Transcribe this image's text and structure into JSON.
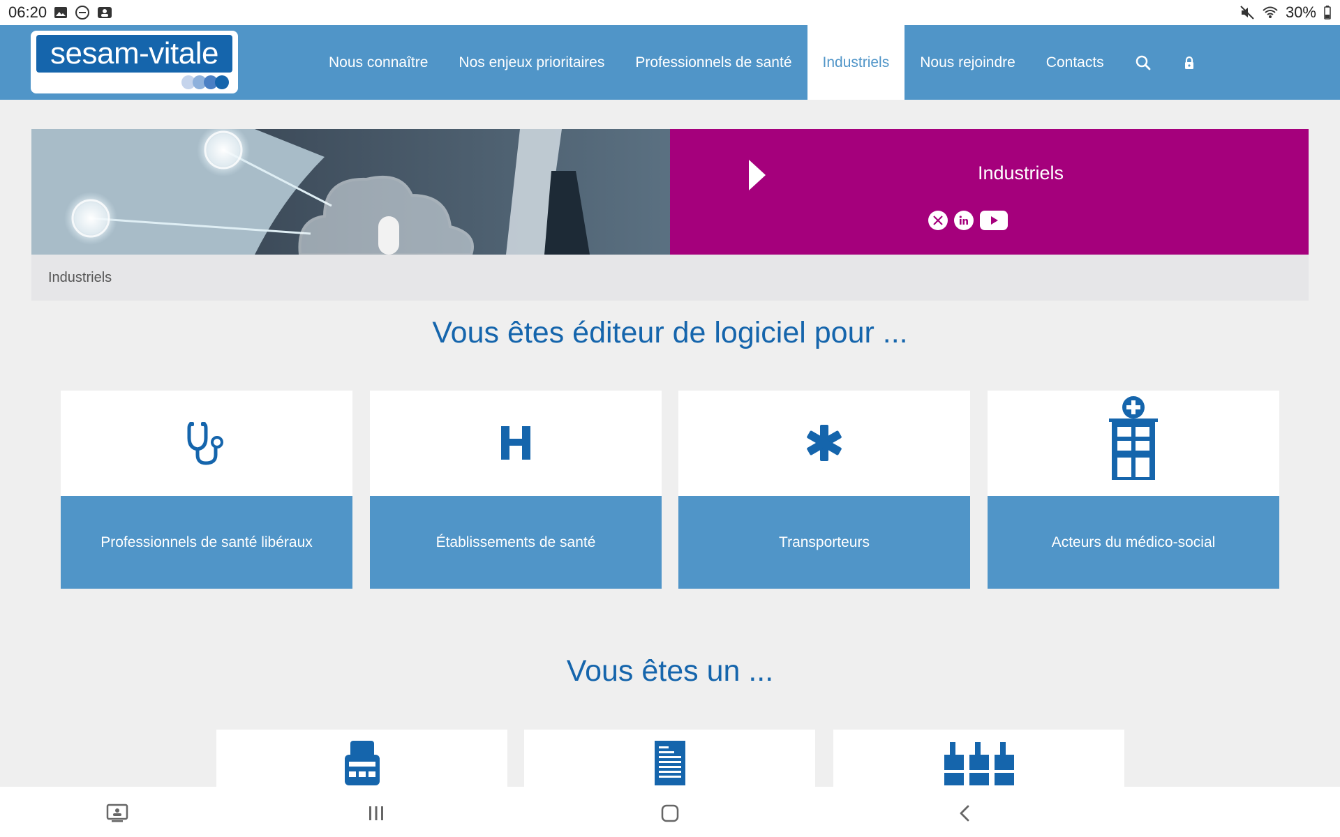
{
  "status_bar": {
    "time": "06:20",
    "battery": "30%",
    "left_icons": [
      "image-icon",
      "dnd-icon",
      "screencast-icon"
    ],
    "right_icons": [
      "mute-icon",
      "wifi-icon",
      "battery-icon"
    ]
  },
  "header": {
    "logo_text": "sesam-vitale",
    "logo_dot_colors": [
      "#c5d4ec",
      "#8eb1dc",
      "#4a7fc4",
      "#1565ac"
    ],
    "nav": [
      {
        "label": "Nous connaître",
        "active": false
      },
      {
        "label": "Nos enjeux prioritaires",
        "active": false
      },
      {
        "label": "Professionnels de santé",
        "active": false
      },
      {
        "label": "Industriels",
        "active": true
      },
      {
        "label": "Nous rejoindre",
        "active": false
      },
      {
        "label": "Contacts",
        "active": false
      }
    ],
    "icons": [
      "search-icon",
      "lock-icon"
    ]
  },
  "hero": {
    "title": "Industriels",
    "socials": [
      "x-icon",
      "linkedin-icon",
      "youtube-icon"
    ],
    "banner_color": "#a5007c"
  },
  "breadcrumb": {
    "current": "Industriels"
  },
  "section1": {
    "title": "Vous êtes éditeur de logiciel pour ...",
    "cards": [
      {
        "label": "Professionnels de santé libéraux",
        "icon": "stethoscope-icon"
      },
      {
        "label": "Établissements de santé",
        "icon": "hospital-h-icon"
      },
      {
        "label": "Transporteurs",
        "icon": "medical-star-icon"
      },
      {
        "label": "Acteurs du médico-social",
        "icon": "medical-building-icon"
      }
    ]
  },
  "section2": {
    "title": "Vous êtes un ...",
    "cards": [
      {
        "icon": "card-terminal-icon"
      },
      {
        "icon": "document-icon"
      },
      {
        "icon": "factory-icon"
      }
    ]
  },
  "nav_bar": {
    "buttons": [
      "screen-icon",
      "recent-apps-icon",
      "home-icon",
      "back-icon"
    ]
  },
  "colors": {
    "primary": "#5095c8",
    "accent_blue": "#1565ac",
    "magenta": "#a5007c",
    "background": "#efefef"
  }
}
